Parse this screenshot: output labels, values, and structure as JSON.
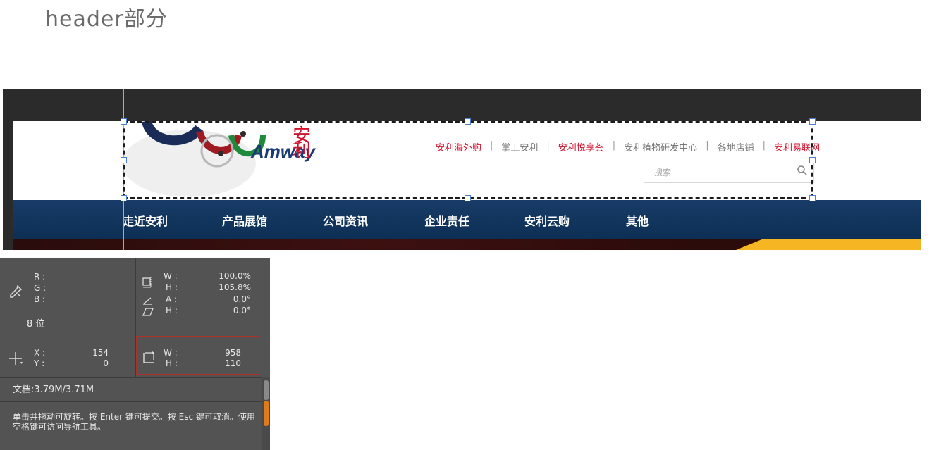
{
  "heading": "header部分",
  "header": {
    "logo_word": "Amway",
    "logo_cn": "安利",
    "top_links": [
      {
        "label": "安利海外购",
        "red": true
      },
      {
        "label": "掌上安利",
        "red": false
      },
      {
        "label": "安利悦享荟",
        "red": true
      },
      {
        "label": "安利植物研发中心",
        "red": false
      },
      {
        "label": "各地店铺",
        "red": false
      },
      {
        "label": "安利易联网",
        "red": true
      }
    ],
    "separator": "|",
    "search_placeholder": "搜索",
    "nav": [
      "走近安利",
      "产品展馆",
      "公司资讯",
      "企业责任",
      "安利云购",
      "其他"
    ]
  },
  "info_panel": {
    "rgb_labels": [
      "R :",
      "G :",
      "B :"
    ],
    "bit_depth": "8 位",
    "transform": {
      "w_label": "W :",
      "w_value": "100.0%",
      "h_label": "H :",
      "h_value": "105.8%",
      "a_label": "A :",
      "a_value": "0.0°",
      "skew_label": "H :",
      "skew_value": "0.0°"
    },
    "position": {
      "x_label": "X :",
      "x_value": "154",
      "y_label": "Y :",
      "y_value": "0"
    },
    "size": {
      "w_label": "W :",
      "w_value": "958",
      "h_label": "H :",
      "h_value": "110"
    },
    "doc_info": "文档:3.79M/3.71M",
    "hint": "单击并拖动可旋转。按 Enter 键可提交。按 Esc 键可取消。使用空格键可访问导航工具。"
  },
  "colors": {
    "nav_bg": "#0f3158",
    "link_red": "#d0122c",
    "banner_yellow": "#f6b523",
    "guide": "#3fd5e8",
    "handle_border": "#4a7fd2"
  }
}
